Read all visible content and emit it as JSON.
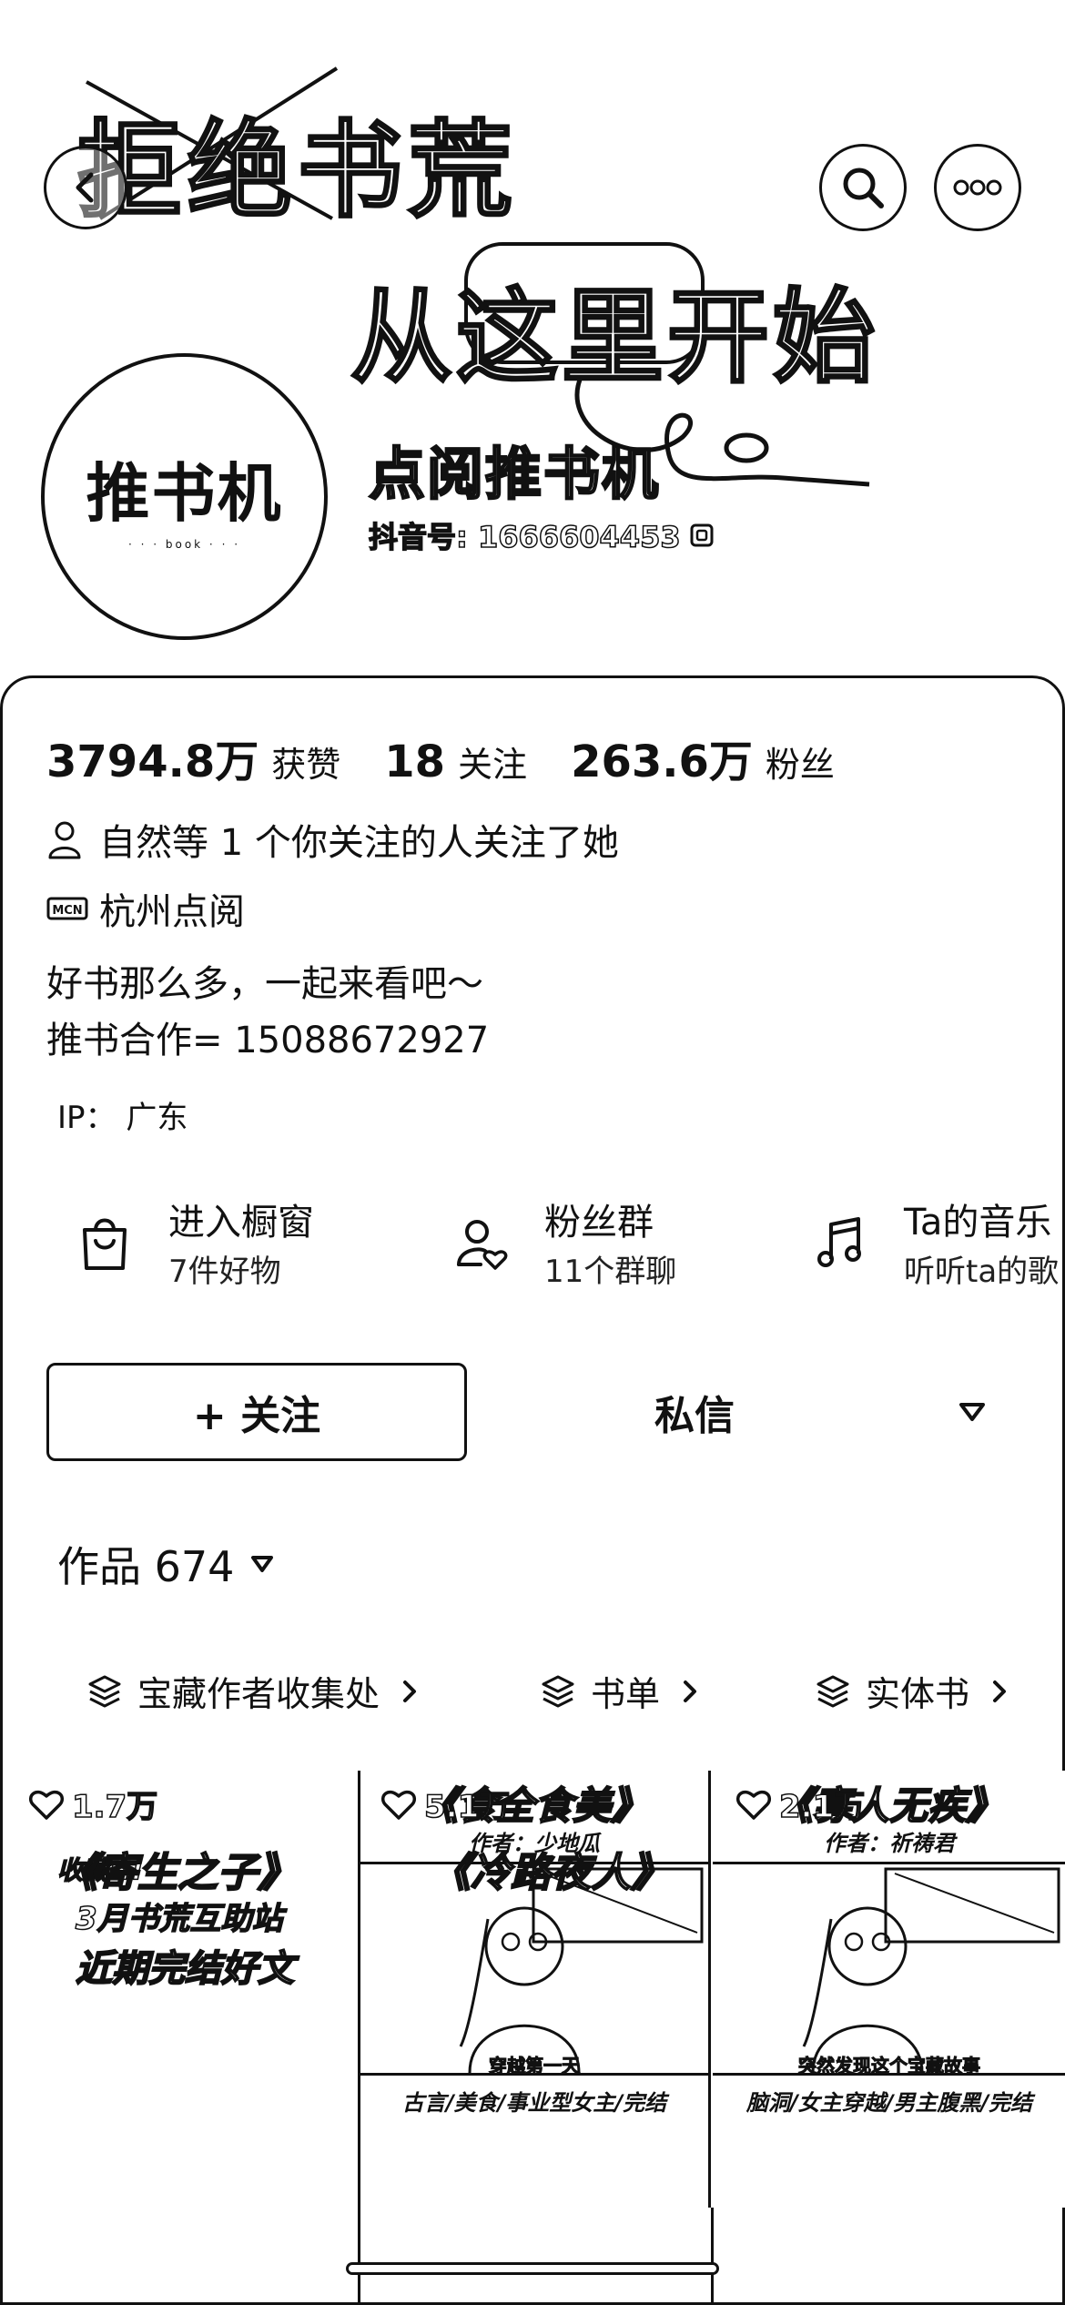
{
  "banner": {
    "tagline_line1": "拒绝书荒",
    "tagline_line2": "从这里开始",
    "nickname": "点阅推书机",
    "douyin_id": "抖音号: 1666604453",
    "avatar_text": "推书机",
    "avatar_sub": "· · · book · · ·"
  },
  "stats": [
    {
      "num": "3794.8万",
      "label": "获赞"
    },
    {
      "num": "18",
      "label": "关注"
    },
    {
      "num": "263.6万",
      "label": "粉丝"
    }
  ],
  "profile": {
    "mutual": "自然等 1 个你关注的人关注了她",
    "mcn": "杭州点阅",
    "bio_line1": "好书那么多，一起来看吧～",
    "bio_line2": "推书合作= 15088672927",
    "ip": "IP： 广东"
  },
  "features": [
    {
      "title": "进入橱窗",
      "sub": "7件好物",
      "icon": "shopping-bag-icon"
    },
    {
      "title": "粉丝群",
      "sub": "11个群聊",
      "icon": "fan-group-icon"
    },
    {
      "title": "Ta的音乐",
      "sub": "听听ta的歌",
      "icon": "music-note-icon"
    }
  ],
  "actions": {
    "follow": "+ 关注",
    "message": "私信"
  },
  "works": {
    "label": "作品 674"
  },
  "collections": [
    {
      "label": "宝藏作者收集处"
    },
    {
      "label": "书单"
    },
    {
      "label": "实体书"
    }
  ],
  "videos": [
    {
      "promo1": "收藏!!!",
      "promo2": "3月书荒互助站",
      "promo3": "近期完结好文",
      "likes": "1.7万"
    },
    {
      "title": "《食全食美》",
      "author": "作者：少地瓜",
      "caption": "穿越第一天",
      "tags": "古言/美食/事业型女主/完结",
      "likes": "5.1万"
    },
    {
      "title": "《寡人无疾》",
      "author": "作者：祈祷君",
      "caption": "突然发现这个宝藏故事",
      "tags": "脑洞/女主穿越/男主腹黑/完结",
      "likes": "2.1万"
    }
  ],
  "next_row": {
    "title1": "《寄生之子》",
    "title2": "《冷路夜人》"
  },
  "colors": {
    "ink": "#111111",
    "background": "#ffffff"
  }
}
